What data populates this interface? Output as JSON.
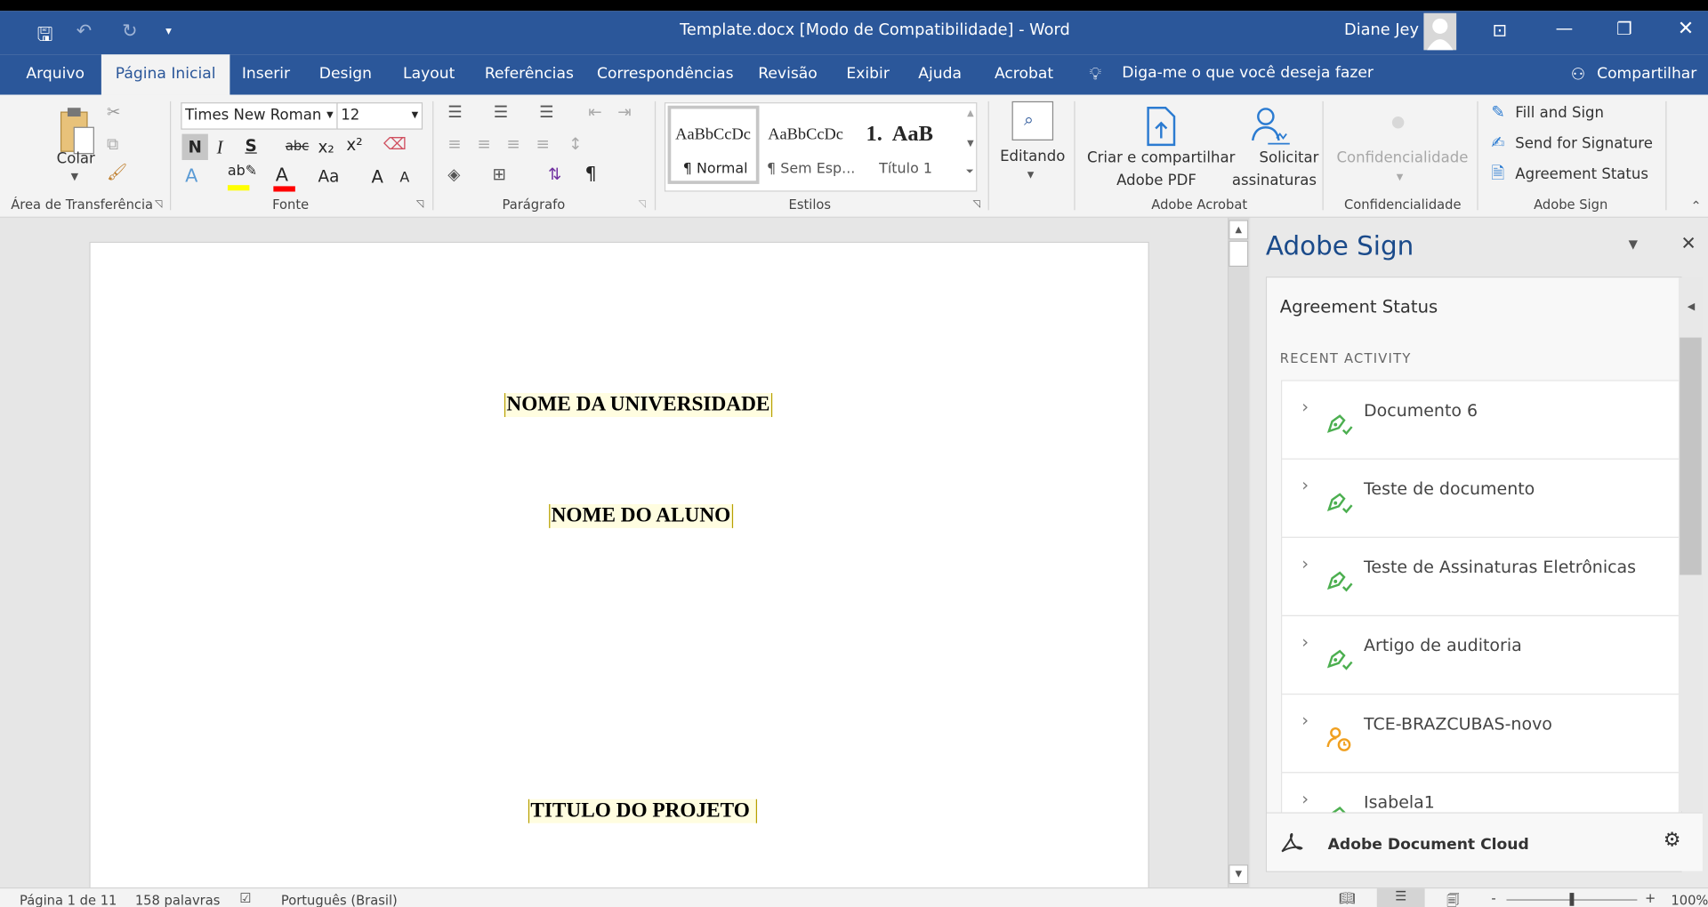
{
  "window": {
    "title": "Template.docx [Modo de Compatibilidade]  -  Word",
    "user": "Diane Jey"
  },
  "qat": {
    "save": "save-icon",
    "undo": "undo-icon",
    "redo": "redo-icon",
    "customize": "▾"
  },
  "tabs": [
    "Arquivo",
    "Página Inicial",
    "Inserir",
    "Design",
    "Layout",
    "Referências",
    "Correspondências",
    "Revisão",
    "Exibir",
    "Ajuda",
    "Acrobat"
  ],
  "tell_me": "Diga-me o que você deseja fazer",
  "share": "Compartilhar",
  "ribbon": {
    "clipboard": {
      "paste": "Colar",
      "label": "Área de Transferência"
    },
    "font": {
      "name": "Times New Roman",
      "size": "12",
      "bold": "N",
      "italic": "I",
      "underline": "S",
      "strike": "abc",
      "sub": "x₂",
      "sup": "x²",
      "grow": "A",
      "shrink": "A",
      "case": "Aa",
      "label": "Fonte",
      "highlight_color": "#ffff00",
      "font_color": "#ff0000"
    },
    "paragraph": {
      "label": "Parágrafo",
      "pilcrow": "¶"
    },
    "styles": {
      "label": "Estilos",
      "items": [
        {
          "preview": "AaBbCcDc",
          "name": "¶ Normal"
        },
        {
          "preview": "AaBbCcDc",
          "name": "¶ Sem Esp..."
        },
        {
          "preview": "1.  AaB",
          "name": "Título 1"
        }
      ]
    },
    "editing": {
      "label": "Editando"
    },
    "acrobat": {
      "create": "Criar e compartilhar",
      "create2": "Adobe PDF",
      "request": "Solicitar",
      "request2": "assinaturas",
      "label": "Adobe Acrobat"
    },
    "confidential": {
      "button": "Confidencialidade",
      "label": "Confidencialidade"
    },
    "sign": {
      "fill": "Fill and Sign",
      "send": "Send for Signature",
      "status": "Agreement Status",
      "label": "Adobe Sign"
    }
  },
  "document": {
    "university": "NOME DA UNIVERSIDADE",
    "student": "NOME DO ALUNO",
    "title": "TITULO DO PROJETO "
  },
  "pane": {
    "title": "Adobe Sign",
    "card_title": "Agreement Status",
    "section": "RECENT ACTIVITY",
    "footer": "Adobe Document Cloud",
    "items": [
      {
        "name": "Documento 6",
        "icon": "signed-icon"
      },
      {
        "name": "Teste de documento",
        "icon": "signed-icon"
      },
      {
        "name": "Teste de Assinaturas Eletrônicas",
        "icon": "signed-icon"
      },
      {
        "name": "Artigo de auditoria",
        "icon": "signed-icon"
      },
      {
        "name": "TCE-BRAZCUBAS-novo",
        "icon": "waiting-icon"
      },
      {
        "name": "Isabela1",
        "icon": "signed-icon"
      }
    ]
  },
  "status": {
    "page": "Página 1 de 11",
    "words": "158 palavras",
    "language": "Português (Brasil)",
    "zoom": "100%",
    "zoom_minus": "-",
    "zoom_plus": "+"
  },
  "colors": {
    "accent": "#2b579a",
    "signed": "#4caf50",
    "waiting": "#f0a020",
    "adobe_title": "#1a4a8a"
  }
}
